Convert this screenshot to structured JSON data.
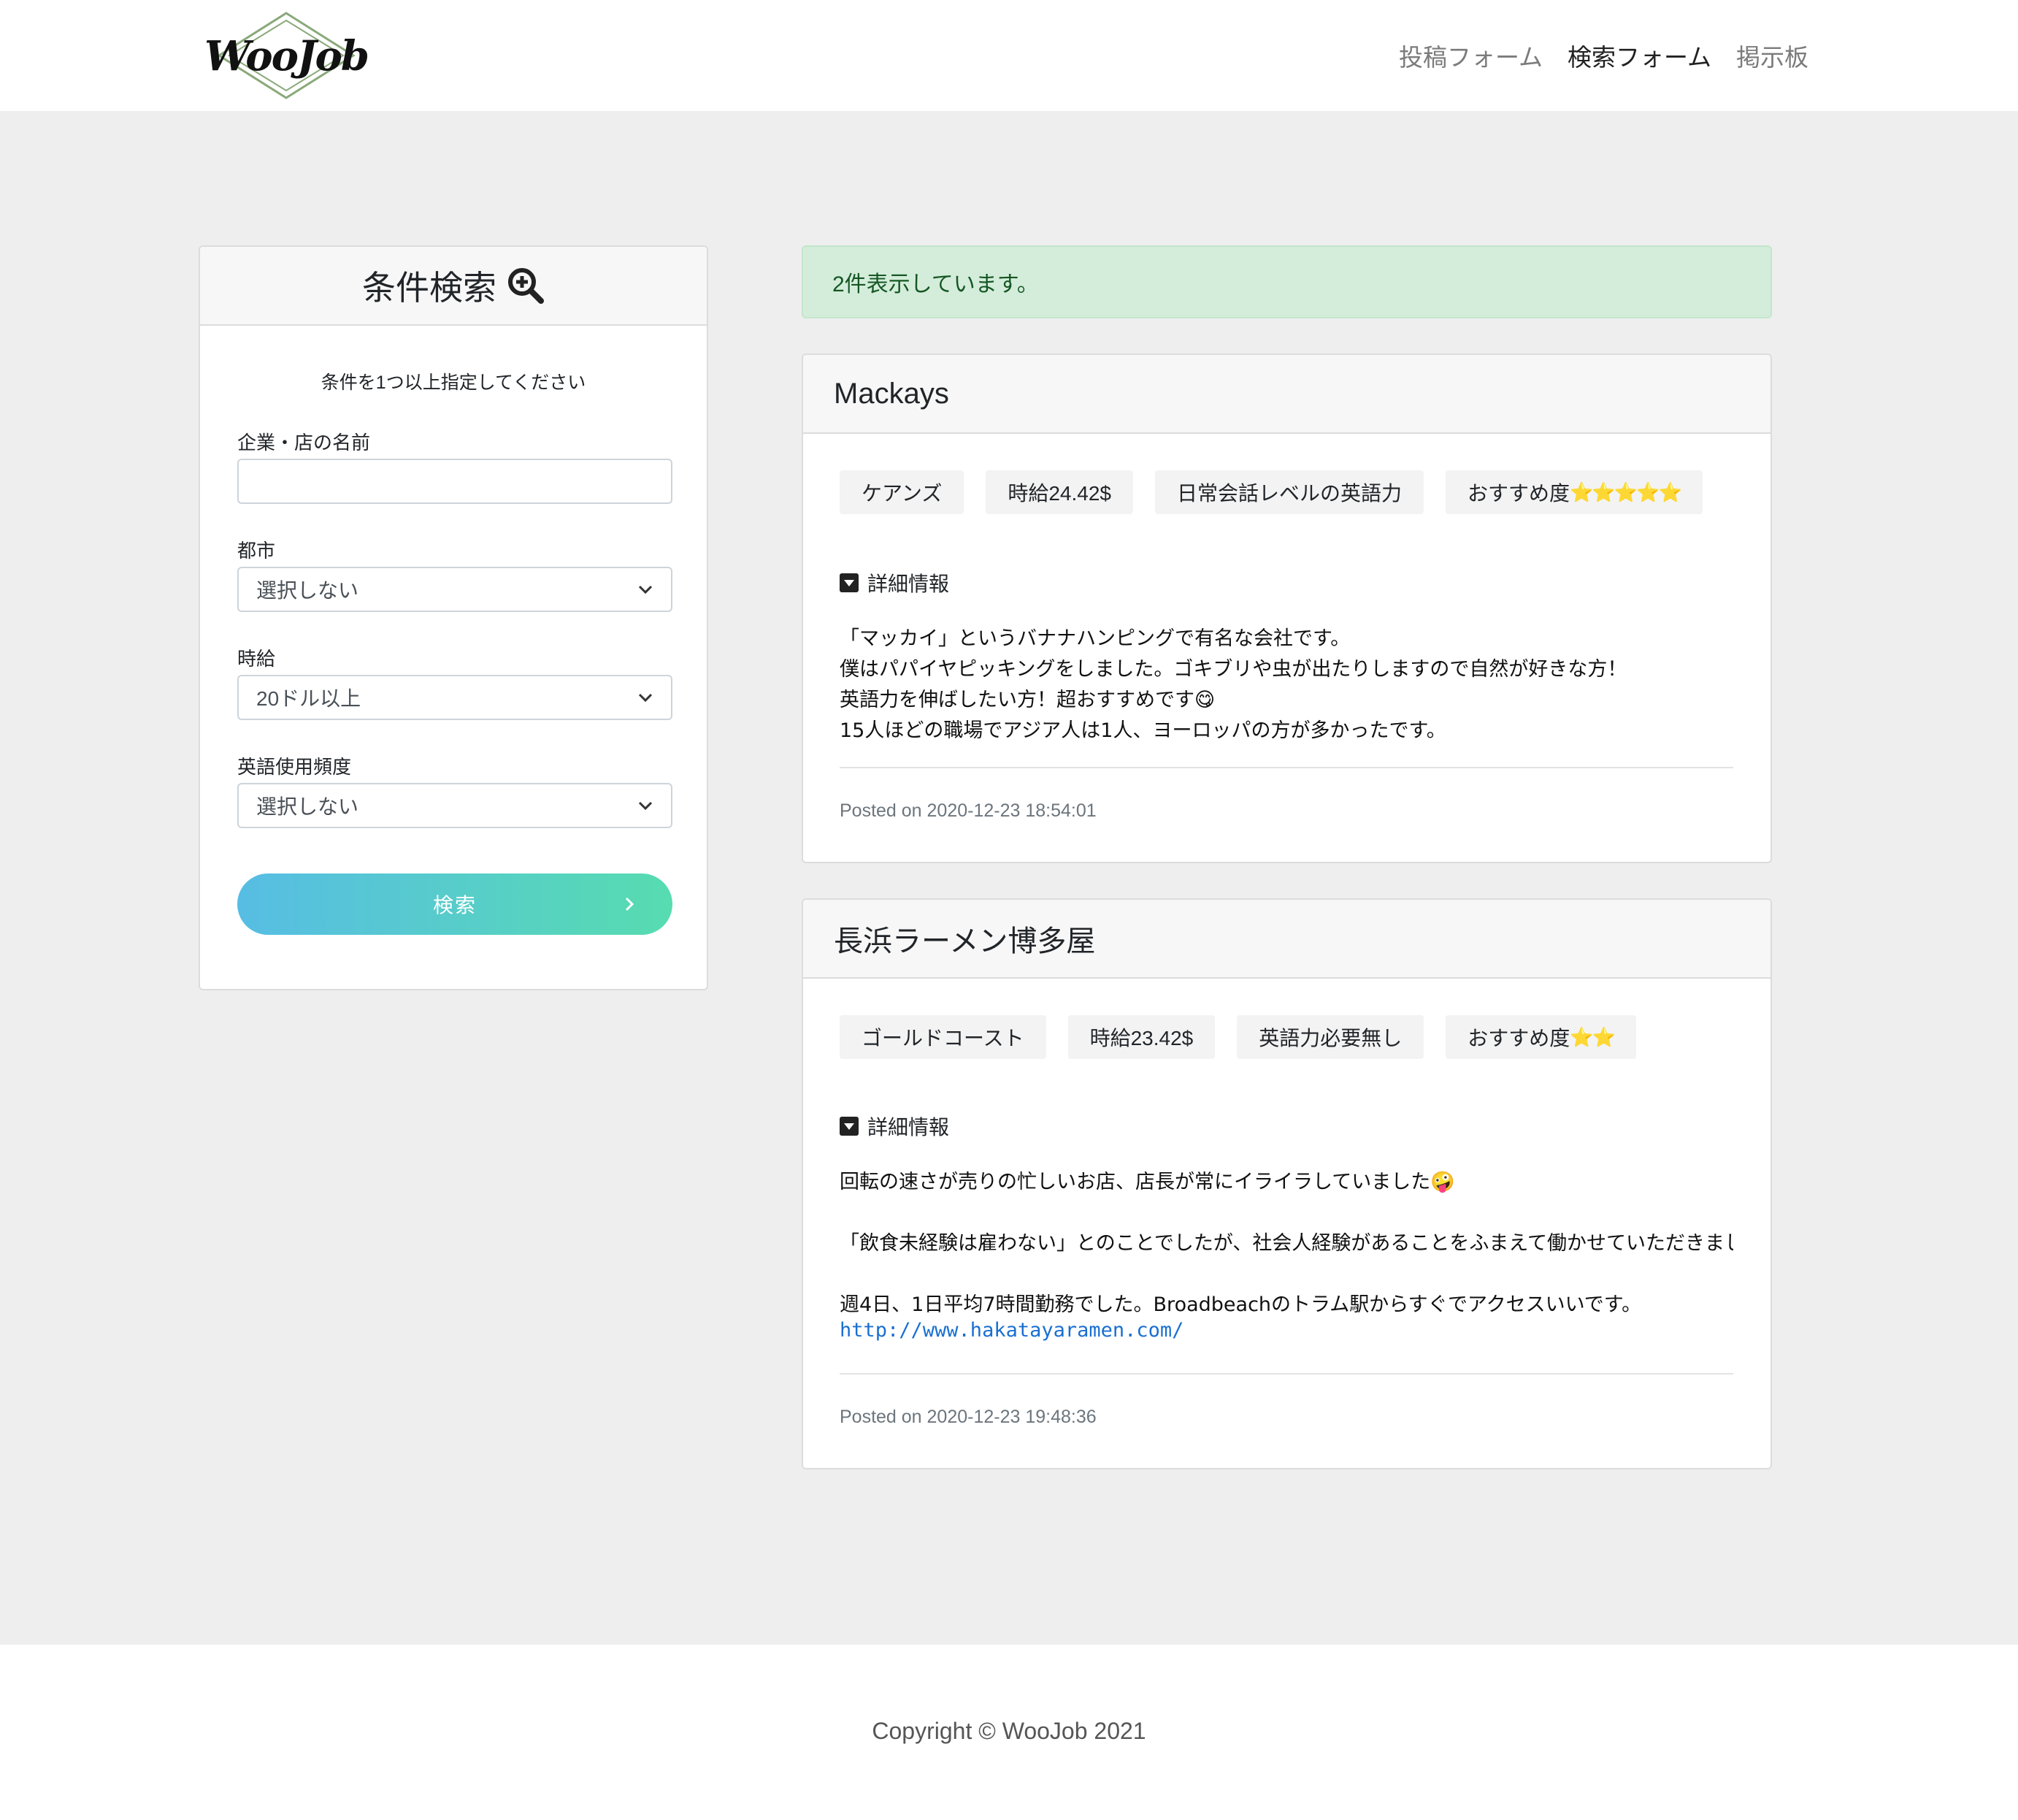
{
  "brand": {
    "logo_text": "WooJob"
  },
  "nav": {
    "items": [
      {
        "label": "投稿フォーム",
        "active": false
      },
      {
        "label": "検索フォーム",
        "active": true
      },
      {
        "label": "掲示板",
        "active": false
      }
    ]
  },
  "search": {
    "title": "条件検索",
    "hint": "条件を1つ以上指定してください",
    "name_label": "企業・店の名前",
    "name_value": "",
    "city_label": "都市",
    "city_value": "選択しない",
    "wage_label": "時給",
    "wage_value": "20ドル以上",
    "english_label": "英語使用頻度",
    "english_value": "選択しない",
    "button_label": "検索"
  },
  "alert": {
    "text": "2件表示しています。"
  },
  "posts": [
    {
      "title": "Mackays",
      "tags": [
        "ケアンズ",
        "時給24.42$",
        "日常会話レベルの英語力"
      ],
      "rating_label": "おすすめ度",
      "rating_stars": "⭐⭐⭐⭐⭐",
      "details_label": "詳細情報",
      "body": [
        "「マッカイ」というバナナハンピングで有名な会社です。",
        "僕はパパイヤピッキングをしました。ゴキブリや虫が出たりしますので自然が好きな方！",
        "英語力を伸ばしたい方！超おすすめです😋",
        "15人ほどの職場でアジア人は1人、ヨーロッパの方が多かったです。"
      ],
      "posted": "Posted on 2020-12-23 18:54:01"
    },
    {
      "title": "長浜ラーメン博多屋",
      "tags": [
        "ゴールドコースト",
        "時給23.42$",
        "英語力必要無し"
      ],
      "rating_label": "おすすめ度",
      "rating_stars": "⭐⭐",
      "details_label": "詳細情報",
      "body": [
        "回転の速さが売りの忙しいお店、店長が常にイライラしていました🤪",
        "「飲食未経験は雇わない」とのことでしたが、社会人経験があることをふまえて働かせていただきました。正",
        "週4日、1日平均7時間勤務でした。Broadbeachのトラム駅からすぐでアクセスいいです。"
      ],
      "link": "http://www.hakatayaramen.com/",
      "posted": "Posted on 2020-12-23 19:48:36"
    }
  ],
  "footer": {
    "copyright": "Copyright © WooJob 2021"
  },
  "colors": {
    "background": "#eeeeee",
    "alert_bg": "#d4edda",
    "alert_text": "#155724",
    "button_gradient_start": "#57bde4",
    "button_gradient_end": "#57dcb0",
    "link": "#1a6fd0"
  }
}
